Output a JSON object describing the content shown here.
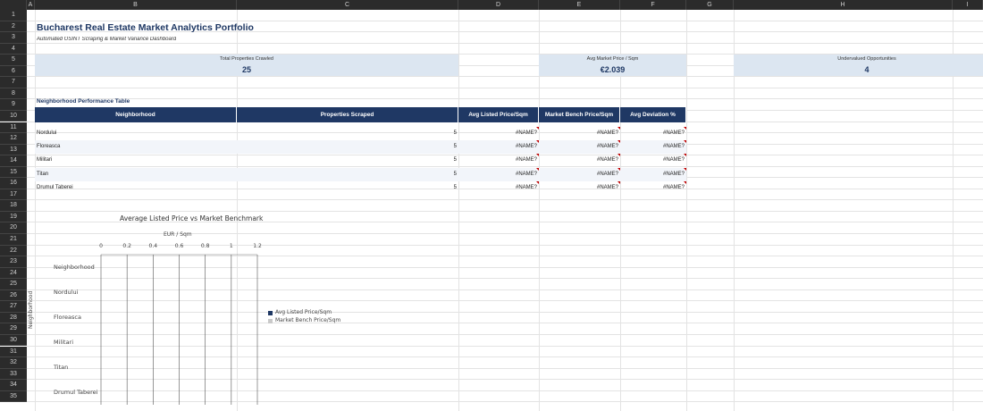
{
  "sheet": {
    "columns": [
      "A",
      "B",
      "C",
      "D",
      "E",
      "F",
      "G",
      "H",
      "I"
    ],
    "rows": [
      "1",
      "2",
      "3",
      "4",
      "5",
      "6",
      "7",
      "8",
      "9",
      "10",
      "11",
      "12",
      "13",
      "14",
      "15",
      "16",
      "17",
      "18",
      "19",
      "20",
      "21",
      "22",
      "23",
      "24",
      "25",
      "26",
      "27",
      "28",
      "29",
      "30",
      "31",
      "32",
      "33",
      "34",
      "35"
    ]
  },
  "header": {
    "title": "Bucharest Real Estate Market Analytics Portfolio",
    "subtitle": "Automated OSINT Scraping & Market Variance Dashboard"
  },
  "kpis": [
    {
      "label": "Total Properties Crawled",
      "value": "25"
    },
    {
      "label": "Avg Market Price / Sqm",
      "value": "€2.039"
    },
    {
      "label": "Undervalued Opportunities",
      "value": "4"
    }
  ],
  "table": {
    "title": "Neighborhood Performance Table",
    "headers": [
      "Neighborhood",
      "Properties Scraped",
      "Avg Listed Price/Sqm",
      "Market Bench Price/Sqm",
      "Avg Deviation %"
    ],
    "rows": [
      {
        "neighborhood": "Nordului",
        "scraped": "5",
        "avg_listed": "#NAME?",
        "bench": "#NAME?",
        "deviation": "#NAME?"
      },
      {
        "neighborhood": "Floreasca",
        "scraped": "5",
        "avg_listed": "#NAME?",
        "bench": "#NAME?",
        "deviation": "#NAME?"
      },
      {
        "neighborhood": "Militari",
        "scraped": "5",
        "avg_listed": "#NAME?",
        "bench": "#NAME?",
        "deviation": "#NAME?"
      },
      {
        "neighborhood": "Titan",
        "scraped": "5",
        "avg_listed": "#NAME?",
        "bench": "#NAME?",
        "deviation": "#NAME?"
      },
      {
        "neighborhood": "Drumul Taberei",
        "scraped": "5",
        "avg_listed": "#NAME?",
        "bench": "#NAME?",
        "deviation": "#NAME?"
      }
    ]
  },
  "chart_data": {
    "type": "bar",
    "orientation": "horizontal",
    "title": "Average Listed Price vs Market Benchmark",
    "xlabel": "EUR / Sqm",
    "ylabel": "Neighborhood",
    "xlim": [
      0,
      1.2
    ],
    "xticks": [
      "0",
      "0.2",
      "0.4",
      "0.6",
      "0.8",
      "1",
      "1.2"
    ],
    "categories": [
      "Neighborhood",
      "Nordului",
      "Floreasca",
      "Militari",
      "Titan",
      "Drumul Taberei"
    ],
    "series": [
      {
        "name": "Avg Listed Price/Sqm",
        "color": "#1f3864",
        "values": [
          0,
          0,
          0,
          0,
          0,
          0
        ]
      },
      {
        "name": "Market Bench Price/Sqm",
        "color": "#c9c9c9",
        "values": [
          0,
          0,
          0,
          0,
          0,
          0
        ]
      }
    ],
    "grid": true,
    "legend": "right"
  },
  "colors": {
    "header_bg": "#1f3864",
    "kpi_bg": "#dce6f1",
    "error_flag": "#c00000"
  }
}
